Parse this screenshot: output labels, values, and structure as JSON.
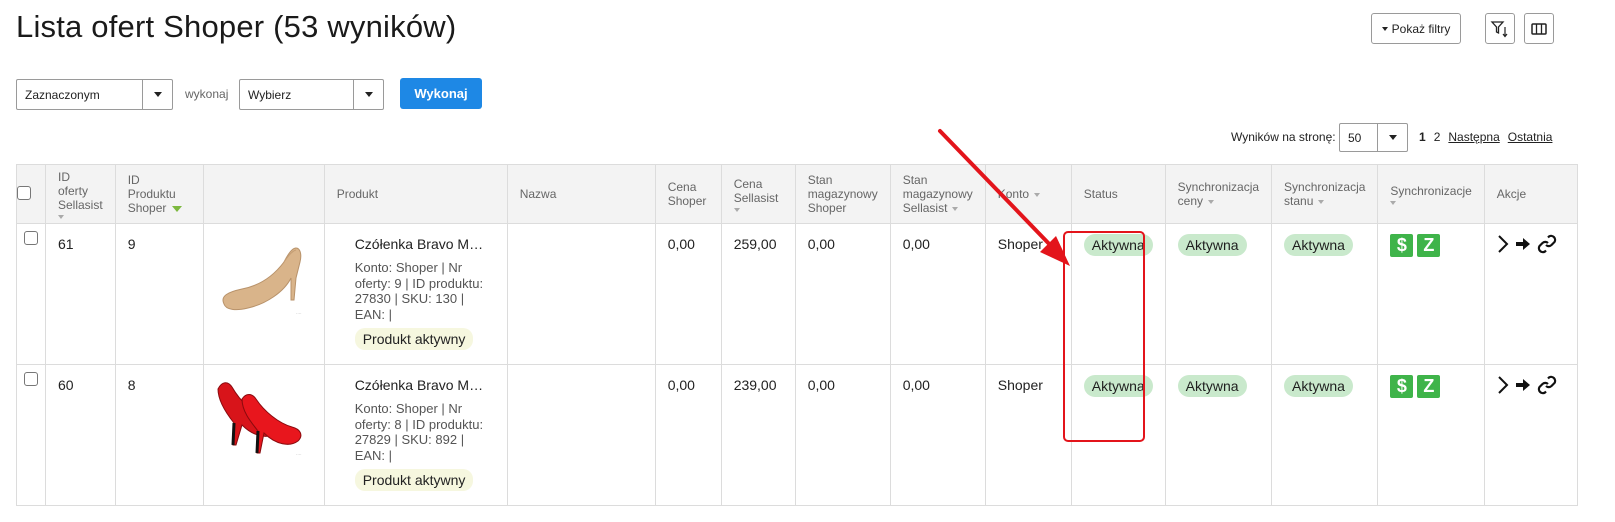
{
  "page": {
    "title": "Lista ofert Shoper (53 wyników)"
  },
  "toolbar": {
    "filters_label": "Pokaż filtry"
  },
  "bulk": {
    "scope_value": "Zaznaczonym",
    "action_label": "wykonaj",
    "action_value": "Wybierz",
    "run_label": "Wykonaj"
  },
  "pagination": {
    "per_page_label": "Wyników na stronę:",
    "per_page_value": "50",
    "pages": [
      "1",
      "2"
    ],
    "next_label": "Następna",
    "last_label": "Ostatnia"
  },
  "table": {
    "headers": {
      "id_offer": [
        "ID",
        "oferty",
        "Sellasist"
      ],
      "id_product": [
        "ID Produktu",
        "Shoper"
      ],
      "product": "Produkt",
      "name": "Nazwa",
      "price_shoper": [
        "Cena",
        "Shoper"
      ],
      "price_sellasist": [
        "Cena",
        "Sellasist"
      ],
      "stock_shoper": [
        "Stan",
        "magazynowy",
        "Shoper"
      ],
      "stock_sellasist": [
        "Stan",
        "magazynowy",
        "Sellasist"
      ],
      "account": "Konto",
      "status": "Status",
      "sync_price": [
        "Synchronizacja",
        "ceny"
      ],
      "sync_stock": [
        "Synchronizacja",
        "stanu"
      ],
      "sync": "Synchronizacje",
      "actions": "Akcje"
    },
    "rows": [
      {
        "id_offer": "61",
        "id_product": "9",
        "image": "beige-pump-shoe",
        "product_name": "Czółenka Bravo Mod...",
        "product_desc": "Konto: Shoper | Nr oferty: 9 | ID produktu: 27830 | SKU: 130 | EAN: |",
        "product_badge": "Produkt aktywny",
        "price_shoper": "0,00",
        "price_sellasist": "259,00",
        "stock_shoper": "0,00",
        "stock_sellasist": "0,00",
        "account": "Shoper",
        "status": "Aktywna",
        "sync_price": "Aktywna",
        "sync_stock": "Aktywna"
      },
      {
        "id_offer": "60",
        "id_product": "8",
        "image": "red-pump-shoes",
        "product_name": "Czółenka Bravo Mod...",
        "product_desc": "Konto: Shoper | Nr oferty: 8 | ID produktu: 27829 | SKU: 892 | EAN: |",
        "product_badge": "Produkt aktywny",
        "price_shoper": "0,00",
        "price_sellasist": "239,00",
        "stock_shoper": "0,00",
        "stock_sellasist": "0,00",
        "account": "Shoper",
        "status": "Aktywna",
        "sync_price": "Aktywna",
        "sync_stock": "Aktywna"
      }
    ]
  },
  "sync_icons": {
    "price_glyph": "$",
    "stock_glyph": "Z"
  },
  "colors": {
    "primary": "#1e88e5",
    "pill_green": "#c9e9cc",
    "sync_green": "#3fb44a",
    "annotation_red": "#e3141b"
  }
}
